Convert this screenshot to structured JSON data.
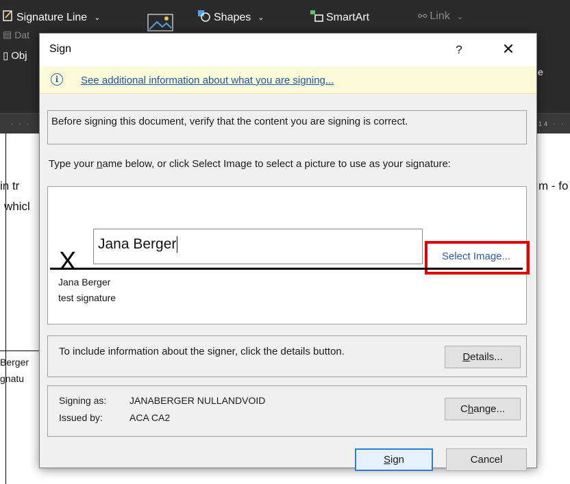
{
  "ribbon": {
    "signature_line": "Signature Line",
    "date_fragment": "Dat",
    "object_fragment": "Obj",
    "shapes": "Shapes",
    "smartart": "SmartArt",
    "link": "Link",
    "right_fragment": "e"
  },
  "ruler": {
    "left_ticks": "· · ·",
    "right_ticks": "14 · · ·"
  },
  "document": {
    "left_line1": "in tr",
    "left_line2": "whicl",
    "right_line1": "m - fo",
    "left_sig1": "Berger",
    "left_sig2": "gnatu"
  },
  "dialog": {
    "title": "Sign",
    "help": "?",
    "close": "✕",
    "info_icon": "i",
    "info_link": "See additional information about what you are signing...",
    "verify_text": "Before signing this document, verify that the content you are signing is correct.",
    "instruction_pre": "Type your ",
    "instruction_mnemonic": "n",
    "instruction_post": "ame below, or click Select Image to select a picture to use as your signature:",
    "x_mark": "X",
    "signature_value": "Jana Berger",
    "select_image": "Select Image...",
    "signer_name": "Jana Berger",
    "signer_title": "test signature",
    "details_text": "To include information about the signer, click the details button.",
    "details_button_mnemonic": "D",
    "details_button_rest": "etails...",
    "signing_as_label": "Signing as:",
    "signing_as_value": "JANABERGER NULLANDVOID",
    "issued_by_label": "Issued by:",
    "issued_by_value": "ACA CA2",
    "change_button_pre": "C",
    "change_button_mnemonic": "h",
    "change_button_post": "ange...",
    "sign_button_mnemonic": "S",
    "sign_button_rest": "ign",
    "cancel_button": "Cancel"
  },
  "colors": {
    "highlight": "#e60000",
    "link": "#1a56a8",
    "infobar": "#fbfbd9"
  }
}
